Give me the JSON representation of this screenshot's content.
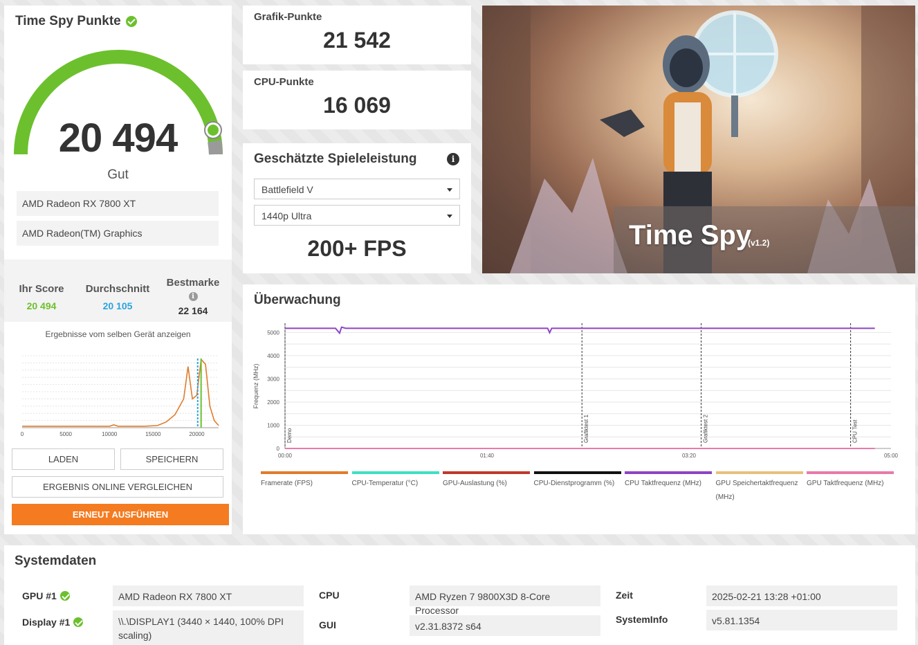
{
  "score_panel": {
    "title": "Time Spy Punkte",
    "score": "20 494",
    "score_value": 20494,
    "rating": "Gut",
    "gpus": [
      "AMD Radeon RX 7800 XT",
      "AMD Radeon(TM) Graphics"
    ],
    "your_score_label": "Ihr Score",
    "your_score": "20 494",
    "average_label": "Durchschnitt",
    "average": "20 105",
    "best_label": "Bestmarke",
    "best": "22 164",
    "same_device_link": "Ergebnisse vom selben Gerät anzeigen",
    "buttons": {
      "load": "LADEN",
      "save": "SPEICHERN",
      "compare_online": "ERGEBNIS ONLINE VERGLEICHEN",
      "run_again": "ERNEUT AUSFÜHREN"
    },
    "colors": {
      "good": "#6cc02d",
      "average": "#2ba4dc",
      "button": "#f47b20"
    }
  },
  "graphics_score": {
    "label": "Grafik-Punkte",
    "value": "21 542"
  },
  "cpu_score": {
    "label": "CPU-Punkte",
    "value": "16 069"
  },
  "game_performance": {
    "title": "Geschätzte Spieleleistung",
    "game": "Battlefield V",
    "preset": "1440p Ultra",
    "fps": "200+ FPS"
  },
  "hero": {
    "title": "Time Spy",
    "version": "(v1.2)"
  },
  "monitoring": {
    "title": "Überwachung",
    "ylabel": "Frequenz (MHz)",
    "y_ticks": [
      "0",
      "1000",
      "2000",
      "3000",
      "4000",
      "5000"
    ],
    "x_ticks": [
      "00:00",
      "01:40",
      "03:20",
      "05:00"
    ],
    "markers": [
      {
        "label": "Demo",
        "t": 0
      },
      {
        "label": "Grafiktest 1",
        "t": 147
      },
      {
        "label": "Grafiktest 2",
        "t": 206
      },
      {
        "label": "CPU Test",
        "t": 280
      }
    ],
    "legend": [
      {
        "label": "Framerate (FPS)",
        "color": "#e07b2a"
      },
      {
        "label": "CPU-Temperatur (°C)",
        "color": "#3ee0c0"
      },
      {
        "label": "GPU-Auslastung (%)",
        "color": "#c0392b"
      },
      {
        "label": "CPU-Dienstprogramm (%)",
        "color": "#111111"
      },
      {
        "label": "CPU Taktfrequenz (MHz)",
        "color": "#8e44c4"
      },
      {
        "label": "GPU Speichertaktfrequenz (MHz)",
        "color": "#e8c07a"
      },
      {
        "label": "GPU Taktfrequenz (MHz)",
        "color": "#e87aa8"
      }
    ]
  },
  "chart_data": [
    {
      "type": "line",
      "title": "Ergebnisse vom selben Gerät anzeigen",
      "x": [
        0,
        2000,
        4000,
        6000,
        8000,
        10000,
        10500,
        11000,
        12000,
        14000,
        15500,
        16500,
        17500,
        18500,
        19000,
        19500,
        20000,
        20500,
        21000,
        21500,
        22000,
        22500
      ],
      "y": [
        2,
        2,
        2,
        2,
        2,
        2,
        4,
        2,
        2,
        2,
        3,
        8,
        18,
        40,
        85,
        40,
        45,
        95,
        88,
        30,
        10,
        3
      ],
      "xlim": [
        0,
        22500
      ],
      "x_ticks": [
        0,
        5000,
        10000,
        15000,
        20000
      ],
      "markers": {
        "your_score": 20494,
        "average": 20105
      }
    },
    {
      "type": "line",
      "title": "Überwachung",
      "ylabel": "Frequenz (MHz)",
      "ylim": [
        0,
        5400
      ],
      "xlim_seconds": [
        0,
        300
      ],
      "series": [
        {
          "name": "CPU Taktfrequenz (MHz)",
          "t": [
            0,
            25,
            27,
            28,
            30,
            60,
            130,
            131,
            132,
            160,
            200,
            250,
            292
          ],
          "values": [
            5180,
            5180,
            4970,
            5230,
            5180,
            5180,
            5180,
            4990,
            5180,
            5180,
            5180,
            5180,
            5180
          ]
        },
        {
          "name": "GPU Taktfrequenz (MHz)",
          "t": [
            0,
            292
          ],
          "values": [
            0,
            0
          ]
        }
      ]
    }
  ],
  "system_data": {
    "title": "Systemdaten",
    "rows": [
      {
        "key": "GPU #1",
        "value": "AMD Radeon RX 7800 XT"
      },
      {
        "key": "Display #1",
        "value": "\\\\.\\DISPLAY1 (3440 × 1440, 100% DPI scaling)"
      },
      {
        "key": "CPU",
        "value": "AMD Ryzen 7 9800X3D 8-Core Processor"
      },
      {
        "key": "GUI",
        "value": "v2.31.8372 s64"
      },
      {
        "key": "Zeit",
        "value": "2025-02-21 13:28 +01:00"
      },
      {
        "key": "SystemInfo",
        "value": "v5.81.1354"
      }
    ]
  }
}
